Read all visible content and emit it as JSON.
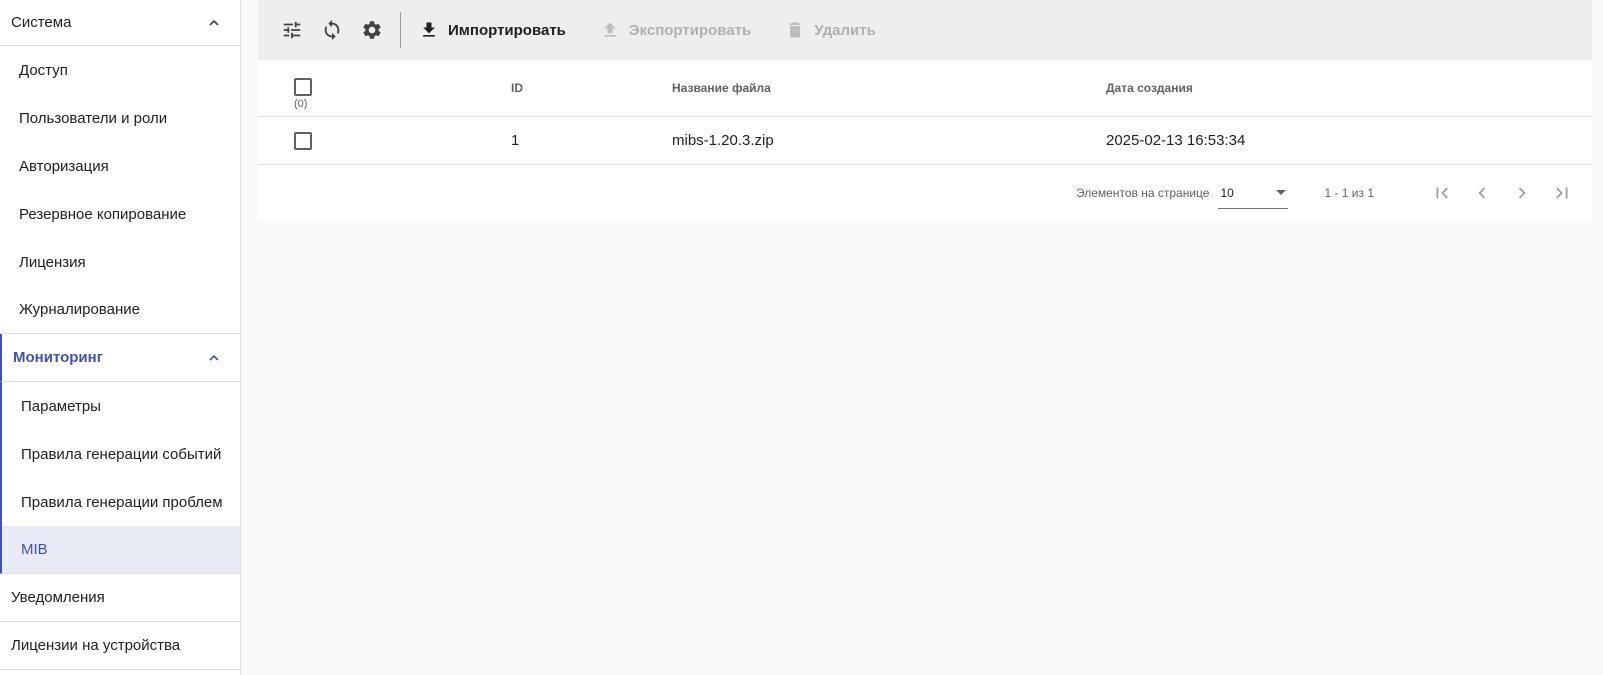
{
  "sidebar": {
    "system": {
      "label": "Система",
      "items": [
        "Доступ",
        "Пользователи и роли",
        "Авторизация",
        "Резервное копирование",
        "Лицензия",
        "Журналирование"
      ]
    },
    "monitoring": {
      "label": "Мониторинг",
      "items": [
        "Параметры",
        "Правила генерации событий",
        "Правила генерации проблем",
        "MIB"
      ],
      "selected": "MIB"
    },
    "bottom": [
      "Уведомления",
      "Лицензии на устройства"
    ]
  },
  "toolbar": {
    "icons": [
      "tune-icon",
      "refresh-icon",
      "settings-icon"
    ],
    "import_label": "Импортировать",
    "export_label": "Экспортировать",
    "delete_label": "Удалить"
  },
  "table": {
    "selected_count": "(0)",
    "columns": {
      "id": "ID",
      "name": "Название файла",
      "date": "Дата создания"
    },
    "rows": [
      {
        "id": "1",
        "name": "mibs-1.20.3.zip",
        "date": "2025-02-13 16:53:34"
      }
    ]
  },
  "paginator": {
    "label": "Элементов на странице",
    "page_size": "10",
    "range": "1 - 1 из 1"
  },
  "colors": {
    "accent": "#3f51b5",
    "selected_bg": "#e8eaf6",
    "toolbar_bg": "#eeeeee"
  }
}
